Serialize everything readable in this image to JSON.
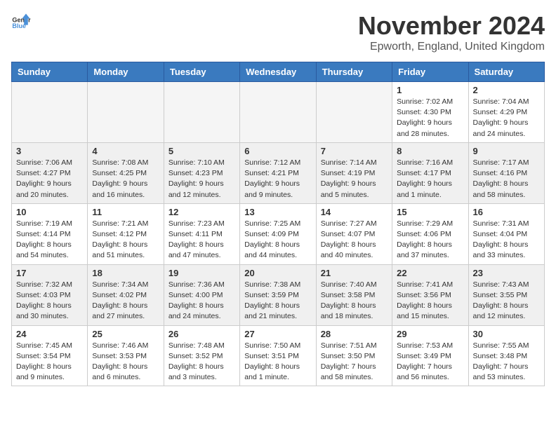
{
  "logo": {
    "text_general": "General",
    "text_blue": "Blue"
  },
  "header": {
    "month": "November 2024",
    "location": "Epworth, England, United Kingdom"
  },
  "days_of_week": [
    "Sunday",
    "Monday",
    "Tuesday",
    "Wednesday",
    "Thursday",
    "Friday",
    "Saturday"
  ],
  "weeks": [
    [
      {
        "day": "",
        "info": ""
      },
      {
        "day": "",
        "info": ""
      },
      {
        "day": "",
        "info": ""
      },
      {
        "day": "",
        "info": ""
      },
      {
        "day": "",
        "info": ""
      },
      {
        "day": "1",
        "info": "Sunrise: 7:02 AM\nSunset: 4:30 PM\nDaylight: 9 hours and 28 minutes."
      },
      {
        "day": "2",
        "info": "Sunrise: 7:04 AM\nSunset: 4:29 PM\nDaylight: 9 hours and 24 minutes."
      }
    ],
    [
      {
        "day": "3",
        "info": "Sunrise: 7:06 AM\nSunset: 4:27 PM\nDaylight: 9 hours and 20 minutes."
      },
      {
        "day": "4",
        "info": "Sunrise: 7:08 AM\nSunset: 4:25 PM\nDaylight: 9 hours and 16 minutes."
      },
      {
        "day": "5",
        "info": "Sunrise: 7:10 AM\nSunset: 4:23 PM\nDaylight: 9 hours and 12 minutes."
      },
      {
        "day": "6",
        "info": "Sunrise: 7:12 AM\nSunset: 4:21 PM\nDaylight: 9 hours and 9 minutes."
      },
      {
        "day": "7",
        "info": "Sunrise: 7:14 AM\nSunset: 4:19 PM\nDaylight: 9 hours and 5 minutes."
      },
      {
        "day": "8",
        "info": "Sunrise: 7:16 AM\nSunset: 4:17 PM\nDaylight: 9 hours and 1 minute."
      },
      {
        "day": "9",
        "info": "Sunrise: 7:17 AM\nSunset: 4:16 PM\nDaylight: 8 hours and 58 minutes."
      }
    ],
    [
      {
        "day": "10",
        "info": "Sunrise: 7:19 AM\nSunset: 4:14 PM\nDaylight: 8 hours and 54 minutes."
      },
      {
        "day": "11",
        "info": "Sunrise: 7:21 AM\nSunset: 4:12 PM\nDaylight: 8 hours and 51 minutes."
      },
      {
        "day": "12",
        "info": "Sunrise: 7:23 AM\nSunset: 4:11 PM\nDaylight: 8 hours and 47 minutes."
      },
      {
        "day": "13",
        "info": "Sunrise: 7:25 AM\nSunset: 4:09 PM\nDaylight: 8 hours and 44 minutes."
      },
      {
        "day": "14",
        "info": "Sunrise: 7:27 AM\nSunset: 4:07 PM\nDaylight: 8 hours and 40 minutes."
      },
      {
        "day": "15",
        "info": "Sunrise: 7:29 AM\nSunset: 4:06 PM\nDaylight: 8 hours and 37 minutes."
      },
      {
        "day": "16",
        "info": "Sunrise: 7:31 AM\nSunset: 4:04 PM\nDaylight: 8 hours and 33 minutes."
      }
    ],
    [
      {
        "day": "17",
        "info": "Sunrise: 7:32 AM\nSunset: 4:03 PM\nDaylight: 8 hours and 30 minutes."
      },
      {
        "day": "18",
        "info": "Sunrise: 7:34 AM\nSunset: 4:02 PM\nDaylight: 8 hours and 27 minutes."
      },
      {
        "day": "19",
        "info": "Sunrise: 7:36 AM\nSunset: 4:00 PM\nDaylight: 8 hours and 24 minutes."
      },
      {
        "day": "20",
        "info": "Sunrise: 7:38 AM\nSunset: 3:59 PM\nDaylight: 8 hours and 21 minutes."
      },
      {
        "day": "21",
        "info": "Sunrise: 7:40 AM\nSunset: 3:58 PM\nDaylight: 8 hours and 18 minutes."
      },
      {
        "day": "22",
        "info": "Sunrise: 7:41 AM\nSunset: 3:56 PM\nDaylight: 8 hours and 15 minutes."
      },
      {
        "day": "23",
        "info": "Sunrise: 7:43 AM\nSunset: 3:55 PM\nDaylight: 8 hours and 12 minutes."
      }
    ],
    [
      {
        "day": "24",
        "info": "Sunrise: 7:45 AM\nSunset: 3:54 PM\nDaylight: 8 hours and 9 minutes."
      },
      {
        "day": "25",
        "info": "Sunrise: 7:46 AM\nSunset: 3:53 PM\nDaylight: 8 hours and 6 minutes."
      },
      {
        "day": "26",
        "info": "Sunrise: 7:48 AM\nSunset: 3:52 PM\nDaylight: 8 hours and 3 minutes."
      },
      {
        "day": "27",
        "info": "Sunrise: 7:50 AM\nSunset: 3:51 PM\nDaylight: 8 hours and 1 minute."
      },
      {
        "day": "28",
        "info": "Sunrise: 7:51 AM\nSunset: 3:50 PM\nDaylight: 7 hours and 58 minutes."
      },
      {
        "day": "29",
        "info": "Sunrise: 7:53 AM\nSunset: 3:49 PM\nDaylight: 7 hours and 56 minutes."
      },
      {
        "day": "30",
        "info": "Sunrise: 7:55 AM\nSunset: 3:48 PM\nDaylight: 7 hours and 53 minutes."
      }
    ]
  ]
}
